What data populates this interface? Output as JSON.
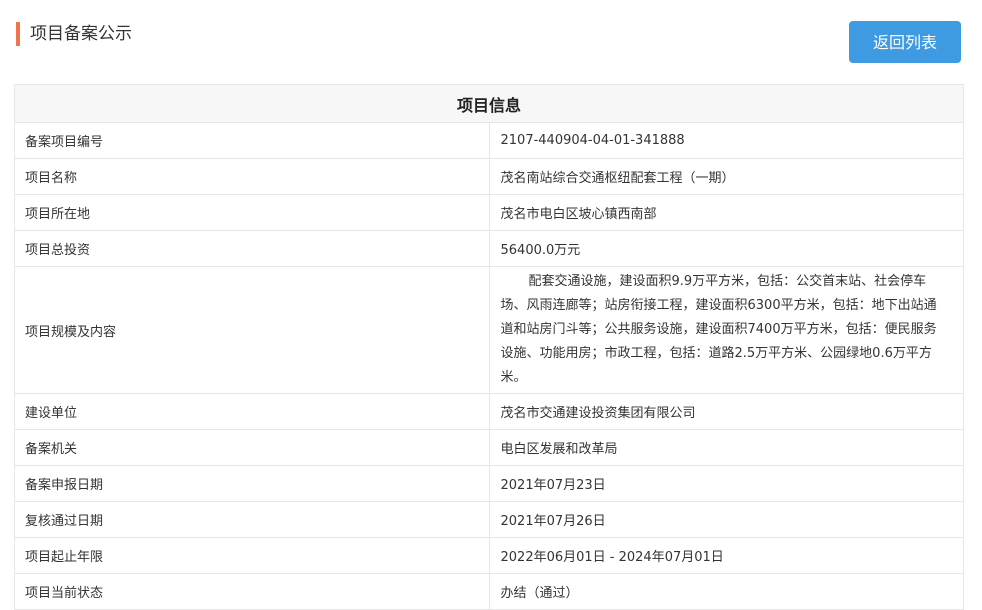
{
  "header": {
    "title": "项目备案公示",
    "back_button": "返回列表",
    "accent_color": "#f0744a",
    "button_color": "#3e9be2"
  },
  "table": {
    "heading": "项目信息",
    "rows": [
      {
        "label": "备案项目编号",
        "value": "2107-440904-04-01-341888"
      },
      {
        "label": "项目名称",
        "value": "茂名南站综合交通枢纽配套工程（一期）"
      },
      {
        "label": "项目所在地",
        "value": "茂名市电白区坡心镇西南部"
      },
      {
        "label": "项目总投资",
        "value": "56400.0万元"
      },
      {
        "label": "项目规模及内容",
        "value": "配套交通设施，建设面积9.9万平方米，包括：公交首末站、社会停车场、风雨连廊等；站房衔接工程，建设面积6300平方米，包括：地下出站通道和站房门斗等；公共服务设施，建设面积7400万平方米，包括：便民服务设施、功能用房；市政工程，包括：道路2.5万平方米、公园绿地0.6万平方米。"
      },
      {
        "label": "建设单位",
        "value": "茂名市交通建设投资集团有限公司"
      },
      {
        "label": "备案机关",
        "value": "电白区发展和改革局"
      },
      {
        "label": "备案申报日期",
        "value": "2021年07月23日"
      },
      {
        "label": "复核通过日期",
        "value": "2021年07月26日"
      },
      {
        "label": "项目起止年限",
        "value": "2022年06月01日 - 2024年07月01日"
      },
      {
        "label": "项目当前状态",
        "value": "办结（通过）"
      }
    ]
  }
}
